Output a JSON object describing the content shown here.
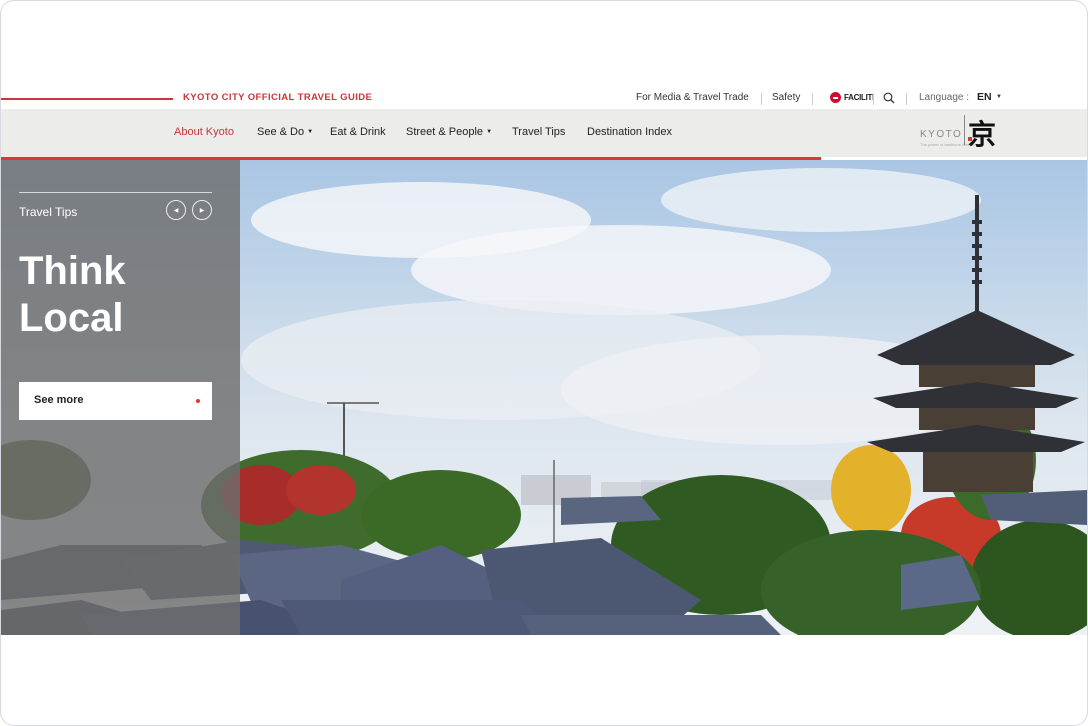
{
  "header": {
    "guide_title": "KYOTO CITY OFFICIAL TRAVEL GUIDE",
    "media_link": "For Media & Travel Trade",
    "safety_link": "Safety",
    "faciliti_label": "FACILITI",
    "language_label": "Language :",
    "language_value": "EN"
  },
  "nav": {
    "items": [
      {
        "label": "About Kyoto",
        "active": true
      },
      {
        "label": "See & Do",
        "dropdown": true
      },
      {
        "label": "Eat & Drink"
      },
      {
        "label": "Street & People",
        "dropdown": true
      },
      {
        "label": "Travel Tips"
      },
      {
        "label": "Destination Index"
      }
    ]
  },
  "logo": {
    "wordmark": "KYOTO",
    "tagline": "The power of traditions lives on",
    "kanji": "京"
  },
  "hero": {
    "category": "Travel Tips",
    "headline_line1": "Think",
    "headline_line2": "Local",
    "cta_label": "See more",
    "prev_icon": "chevron-left-icon",
    "next_icon": "chevron-right-icon"
  },
  "colors": {
    "accent_red": "#c8373a",
    "nav_bg": "#ececea",
    "panel_gray": "#6e6e6e"
  }
}
